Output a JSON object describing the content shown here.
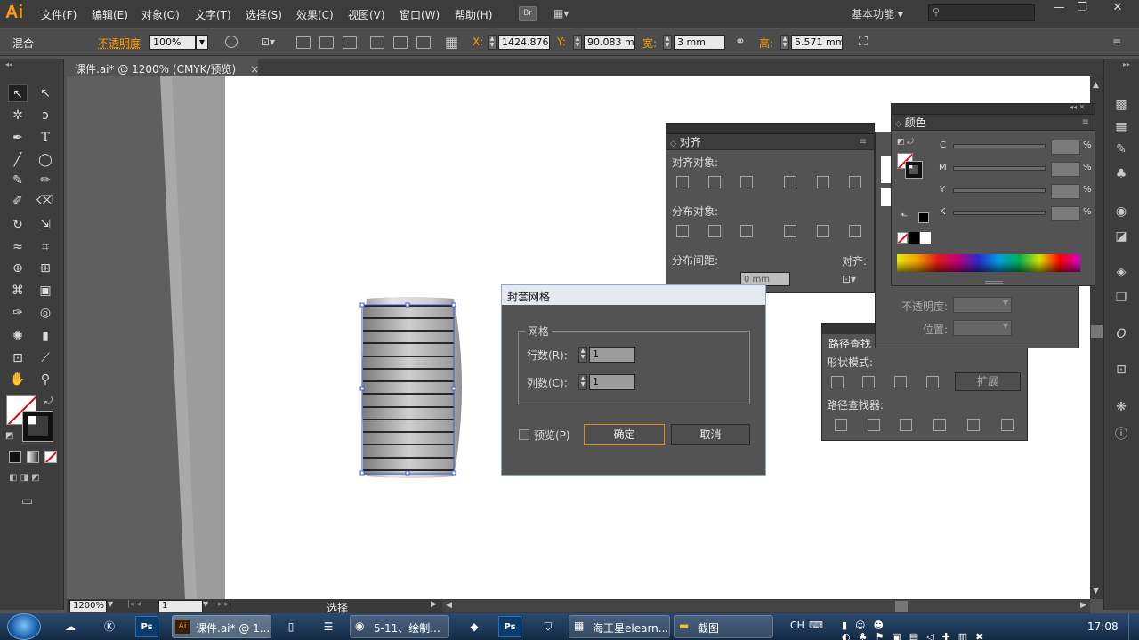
{
  "app": {
    "logo": "Ai"
  },
  "menubar": {
    "items": [
      "文件(F)",
      "编辑(E)",
      "对象(O)",
      "文字(T)",
      "选择(S)",
      "效果(C)",
      "视图(V)",
      "窗口(W)",
      "帮助(H)"
    ],
    "bridge": "Br",
    "workspace": "基本功能",
    "window_controls": [
      "—",
      "❐",
      "✕"
    ]
  },
  "control_bar": {
    "mode": "混合",
    "opacity_label": "不透明度",
    "opacity_value": "100%",
    "x_label": "X:",
    "x_value": "1424.876",
    "y_label": "Y:",
    "y_value": "90.083 mm",
    "w_label": "宽:",
    "w_value": "3 mm",
    "h_label": "高:",
    "h_value": "5.571 mm"
  },
  "document": {
    "tab_title": "课件.ai* @ 1200% (CMYK/预览)",
    "close": "×"
  },
  "status": {
    "zoom": "1200%",
    "page": "1",
    "tool": "选择"
  },
  "align_panel": {
    "title": "对齐",
    "align_objects": "对齐对象:",
    "distribute_objects": "分布对象:",
    "distribute_spacing": "分布间距:",
    "align_to": "对齐:",
    "spacing_value": "0 mm"
  },
  "color_panel": {
    "title": "颜色",
    "channels": [
      "C",
      "M",
      "Y",
      "K"
    ],
    "percent": "%"
  },
  "transparency_panel": {
    "opacity_label": "不透明度:",
    "position_label": "位置:"
  },
  "pathfinder_panel": {
    "title": "路径查找",
    "shape_modes": "形状模式:",
    "expand": "扩展",
    "pathfinders": "路径查找器:"
  },
  "envelope_dialog": {
    "title": "封套网格",
    "group": "网格",
    "rows_label": "行数(R):",
    "rows_value": "1",
    "cols_label": "列数(C):",
    "cols_value": "1",
    "preview": "预览(P)",
    "ok": "确定",
    "cancel": "取消"
  },
  "taskbar": {
    "buttons": [
      "课件.ai* @ 1...",
      "5-11、绘制...",
      "海王星elearn...",
      "截图"
    ],
    "ime": "CH",
    "time": "17:08"
  },
  "colors": {
    "accent": "#ff9a00",
    "ok_border": "#e08a16",
    "selection": "#3c5ad6"
  }
}
